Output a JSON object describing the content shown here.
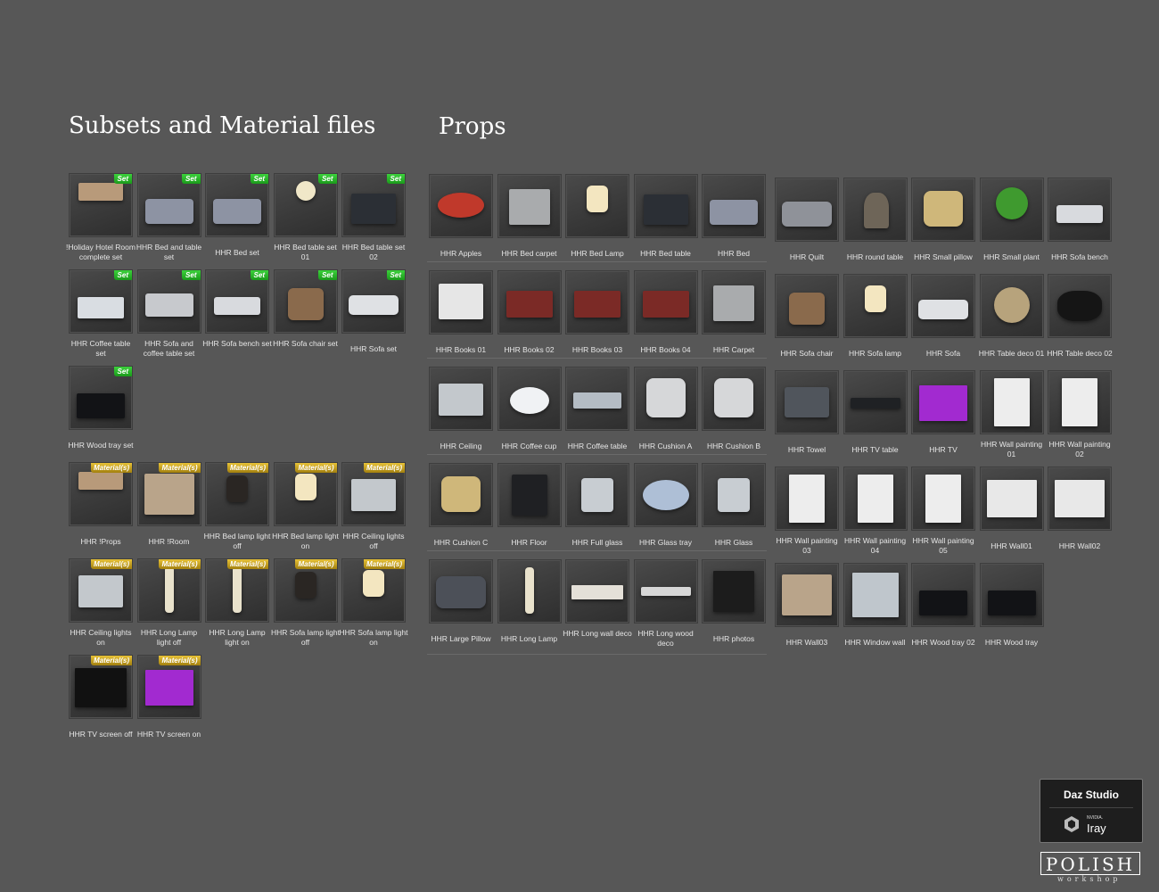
{
  "headings": {
    "subsets": "Subsets and Material files",
    "props": "Props"
  },
  "badges": {
    "set": "Set",
    "material": "Material(s)"
  },
  "subsets": [
    {
      "label": "!Holiday Hotel Room complete set",
      "badge": "Set",
      "icon": "room-icon"
    },
    {
      "label": "HHR Bed and table set",
      "badge": "Set",
      "icon": "bed-icon"
    },
    {
      "label": "HHR Bed set",
      "badge": "Set",
      "icon": "bed-icon"
    },
    {
      "label": "HHR Bed table set 01",
      "badge": "Set",
      "icon": "bedside-lamp-icon"
    },
    {
      "label": "HHR Bed table set 02",
      "badge": "Set",
      "icon": "bedside-table-icon"
    },
    {
      "label": "HHR Coffee table set",
      "badge": "Set",
      "icon": "coffee-table-icon"
    },
    {
      "label": "HHR Sofa and coffee table set",
      "badge": "Set",
      "icon": "sofa-set-icon"
    },
    {
      "label": "HHR Sofa bench set",
      "badge": "Set",
      "icon": "bench-icon"
    },
    {
      "label": "HHR Sofa chair set",
      "badge": "Set",
      "icon": "chair-icon"
    },
    {
      "label": "HHR Sofa set",
      "badge": "Set",
      "icon": "sofa-icon"
    },
    {
      "label": "HHR Wood tray set",
      "badge": "Set",
      "icon": "tray-icon"
    }
  ],
  "materials": [
    {
      "label": "HHR !Props",
      "badge": "Material(s)",
      "icon": "room-icon"
    },
    {
      "label": "HHR !Room",
      "badge": "Material(s)",
      "icon": "wall-panel-icon"
    },
    {
      "label": "HHR Bed lamp light off",
      "badge": "Material(s)",
      "icon": "lamp-off-icon"
    },
    {
      "label": "HHR Bed lamp light on",
      "badge": "Material(s)",
      "icon": "lamp-on-icon"
    },
    {
      "label": "HHR Ceiling lights off",
      "badge": "Material(s)",
      "icon": "ceiling-icon"
    },
    {
      "label": "HHR Ceiling lights on",
      "badge": "Material(s)",
      "icon": "ceiling-icon"
    },
    {
      "label": "HHR Long Lamp light off",
      "badge": "Material(s)",
      "icon": "long-lamp-icon"
    },
    {
      "label": "HHR Long Lamp light on",
      "badge": "Material(s)",
      "icon": "long-lamp-icon"
    },
    {
      "label": "HHR Sofa lamp light off",
      "badge": "Material(s)",
      "icon": "lamp-off-icon"
    },
    {
      "label": "HHR Sofa lamp light on",
      "badge": "Material(s)",
      "icon": "lamp-on-icon"
    },
    {
      "label": "HHR TV screen off",
      "badge": "Material(s)",
      "icon": "tv-off-icon"
    },
    {
      "label": "HHR TV screen on",
      "badge": "Material(s)",
      "icon": "tv-on-icon"
    }
  ],
  "props_left": [
    {
      "label": "HHR Apples",
      "icon": "apples-icon"
    },
    {
      "label": "HHR Bed carpet",
      "icon": "carpet-icon"
    },
    {
      "label": "HHR Bed Lamp",
      "icon": "lamp-on-icon"
    },
    {
      "label": "HHR Bed table",
      "icon": "bedside-table-icon"
    },
    {
      "label": "HHR Bed",
      "icon": "bed-icon"
    },
    {
      "label": "HHR Books 01",
      "icon": "book-icon"
    },
    {
      "label": "HHR Books 02",
      "icon": "books-icon"
    },
    {
      "label": "HHR Books 03",
      "icon": "books-icon"
    },
    {
      "label": "HHR Books 04",
      "icon": "books-icon"
    },
    {
      "label": "HHR Carpet",
      "icon": "carpet-icon"
    },
    {
      "label": "HHR Ceiling",
      "icon": "ceiling-icon"
    },
    {
      "label": "HHR Coffee cup",
      "icon": "cup-icon"
    },
    {
      "label": "HHR Coffee table",
      "icon": "glass-table-icon"
    },
    {
      "label": "HHR Cushion A",
      "icon": "cushion-icon"
    },
    {
      "label": "HHR Cushion B",
      "icon": "cushion-icon"
    },
    {
      "label": "HHR Cushion C",
      "icon": "cushion-gold-icon"
    },
    {
      "label": "HHR Floor",
      "icon": "floor-icon"
    },
    {
      "label": "HHR Full glass",
      "icon": "glass-icon"
    },
    {
      "label": "HHR Glass tray",
      "icon": "glass-tray-icon"
    },
    {
      "label": "HHR Glass",
      "icon": "glass-icon"
    },
    {
      "label": "HHR Large Pillow",
      "icon": "pillow-icon"
    },
    {
      "label": "HHR Long Lamp",
      "icon": "long-lamp-icon"
    },
    {
      "label": "HHR Long wall deco",
      "icon": "wall-deco-icon"
    },
    {
      "label": "HHR Long wood deco",
      "icon": "branch-icon"
    },
    {
      "label": "HHR photos",
      "icon": "photos-icon"
    }
  ],
  "props_right": [
    {
      "label": "HHR Quilt",
      "icon": "quilt-icon"
    },
    {
      "label": "HHR round table",
      "icon": "round-table-icon"
    },
    {
      "label": "HHR Small pillow",
      "icon": "cushion-gold-icon"
    },
    {
      "label": "HHR Small plant",
      "icon": "plant-icon"
    },
    {
      "label": "HHR Sofa bench",
      "icon": "bench-icon"
    },
    {
      "label": "HHR Sofa chair",
      "icon": "chair-icon"
    },
    {
      "label": "HHR Sofa lamp",
      "icon": "lamp-on-icon"
    },
    {
      "label": "HHR Sofa",
      "icon": "sofa-icon"
    },
    {
      "label": "HHR Table deco 01",
      "icon": "deco-icon"
    },
    {
      "label": "HHR Table deco 02",
      "icon": "sculpture-icon"
    },
    {
      "label": "HHR Towel",
      "icon": "towel-icon"
    },
    {
      "label": "HHR TV table",
      "icon": "tv-table-icon"
    },
    {
      "label": "HHR TV",
      "icon": "tv-on-icon"
    },
    {
      "label": "HHR Wall painting 01",
      "icon": "painting-icon"
    },
    {
      "label": "HHR Wall painting 02",
      "icon": "painting-icon"
    },
    {
      "label": "HHR Wall painting 03",
      "icon": "painting-icon"
    },
    {
      "label": "HHR Wall painting 04",
      "icon": "painting-icon"
    },
    {
      "label": "HHR Wall painting 05",
      "icon": "painting-icon"
    },
    {
      "label": "HHR Wall01",
      "icon": "wall-icon"
    },
    {
      "label": "HHR Wall02",
      "icon": "wall-icon"
    },
    {
      "label": "HHR Wall03",
      "icon": "wall-panel-icon"
    },
    {
      "label": "HHR Window wall",
      "icon": "window-icon"
    },
    {
      "label": "HHR Wood tray 02",
      "icon": "tray-icon"
    },
    {
      "label": "HHR Wood tray",
      "icon": "tray-icon"
    }
  ],
  "logos": {
    "daz": "Daz Studio",
    "nvidia": "NVIDIA.",
    "iray": "Iray",
    "polish": "POLISH",
    "workshop": "workshop"
  },
  "colors": {
    "background": "#575757",
    "set_badge": "#2bb52b",
    "material_badge": "#c9a322"
  }
}
